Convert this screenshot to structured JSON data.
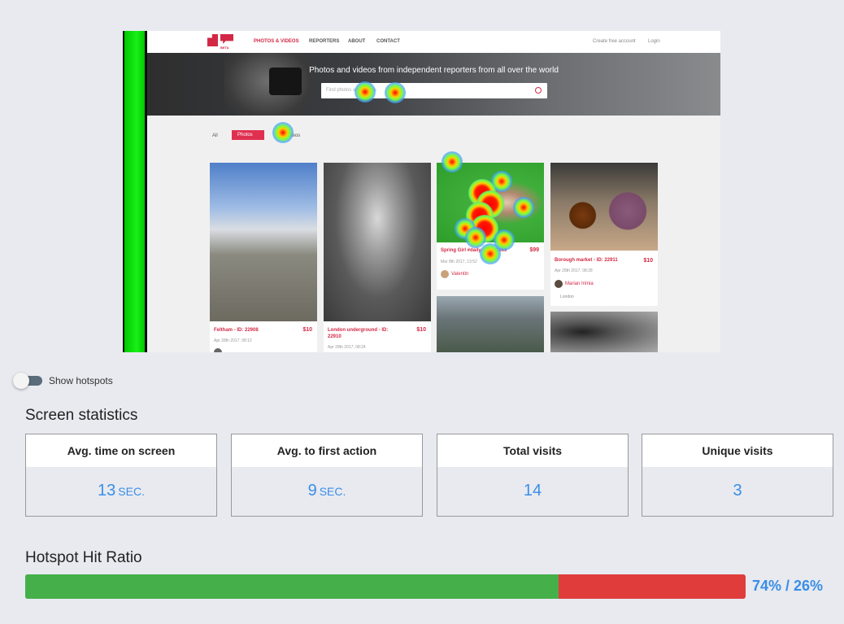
{
  "preview": {
    "nav": {
      "logo_text": "BETA",
      "items": [
        "PHOTOS & VIDEOS",
        "REPORTERS",
        "ABOUT",
        "CONTACT"
      ],
      "right": [
        "Create free account",
        "Login"
      ]
    },
    "hero": {
      "title": "Photos and videos from independent reporters from all over the world",
      "search_placeholder": "Find photos and videos"
    },
    "filters": {
      "all": "All",
      "photos": "Photos",
      "videos": "Videos"
    },
    "cards": [
      {
        "title": "Feltham - ID: 22908",
        "price": "$10",
        "date": "Apr 28th 2017, 08:12"
      },
      {
        "title": "London underground - ID: 22910",
        "price": "$10",
        "date": "Apr 28th 2017, 08:24"
      },
      {
        "title": "Spring Girl #daily - ID: 21669",
        "price": "$99",
        "date": "Mar 8th 2017, 13:52",
        "author": "Valentin"
      },
      {
        "title": "Borough market - ID: 22911",
        "price": "$10",
        "date": "Apr 28th 2017, 08:28",
        "author": "Marian Irimia",
        "location": "London"
      }
    ]
  },
  "hotspots_toggle": {
    "label": "Show hotspots",
    "on": false
  },
  "screen_statistics": {
    "title": "Screen statistics",
    "cards": [
      {
        "label": "Avg. time on screen",
        "value": "13",
        "unit": "SEC."
      },
      {
        "label": "Avg. to first action",
        "value": "9",
        "unit": "SEC."
      },
      {
        "label": "Total visits",
        "value": "14",
        "unit": ""
      },
      {
        "label": "Unique visits",
        "value": "3",
        "unit": ""
      }
    ]
  },
  "hotspot_hit_ratio": {
    "title": "Hotspot Hit Ratio",
    "hit_fraction": 0.74,
    "text": "74% / 26%",
    "colors": {
      "hit": "#45b049",
      "miss": "#e03c3c",
      "text": "#3a8ee6"
    }
  }
}
